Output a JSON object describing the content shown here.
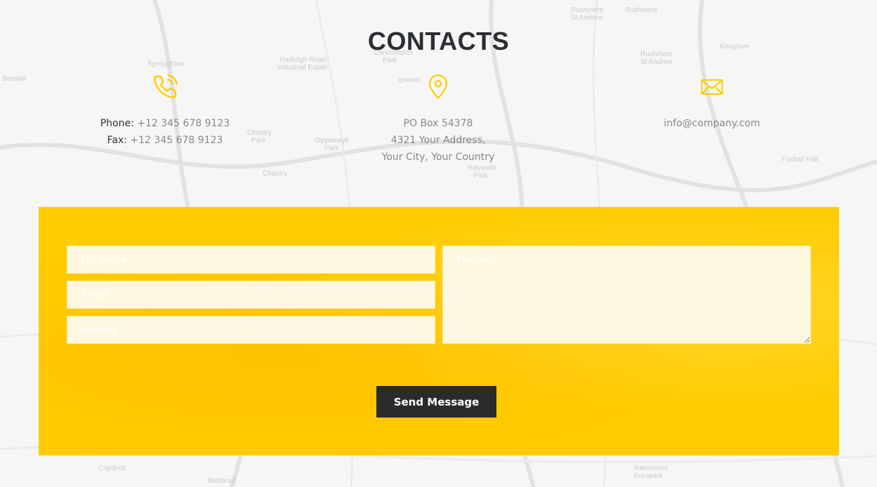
{
  "page": {
    "title": "CONTACTS"
  },
  "contacts": {
    "phone": {
      "icon": "phone-icon",
      "phone_label": "Phone:",
      "phone_value": "+12 345 678 9123",
      "fax_label": "Fax:",
      "fax_value": "+12 345 678 9123"
    },
    "address": {
      "icon": "map-pin-icon",
      "line1": "PO Box 54378",
      "line2": "4321 Your Address,",
      "line3": "Your City, Your Country"
    },
    "email": {
      "icon": "envelope-icon",
      "value": "info@company.com"
    }
  },
  "form": {
    "full_name_placeholder": "Full Name",
    "email_placeholder": "Email",
    "subject_placeholder": "Subject",
    "message_placeholder": "Message",
    "send_label": "Send Message"
  },
  "map_labels": [
    "Sproughton",
    "Hadleigh Road Industrial Estate",
    "Christchurch Park",
    "Ipswich",
    "Rushmere St Andrew",
    "Rushmere",
    "Kesgrave",
    "Chantry Park",
    "Gippeswyk Park",
    "Holywells Park",
    "Chantry",
    "Foxhall Hall",
    "Copdock",
    "Belstead",
    "Ransomes Europark",
    "Burstall"
  ],
  "colors": {
    "accent": "#ffcc00",
    "button": "#2b2b2b",
    "title": "#2b2f33"
  }
}
